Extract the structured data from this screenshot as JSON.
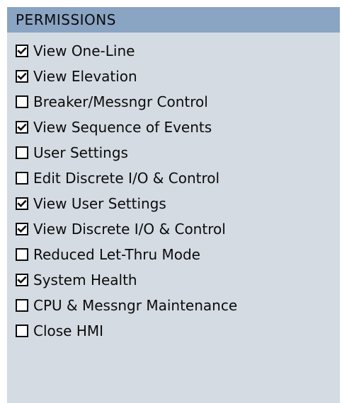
{
  "panel": {
    "title": "PERMISSIONS",
    "items": [
      {
        "label": "View One-Line",
        "checked": true
      },
      {
        "label": "View Elevation",
        "checked": true
      },
      {
        "label": "Breaker/Messngr Control",
        "checked": false
      },
      {
        "label": "View Sequence of Events",
        "checked": true
      },
      {
        "label": "User Settings",
        "checked": false
      },
      {
        "label": "Edit Discrete I/O & Control",
        "checked": false
      },
      {
        "label": "View User Settings",
        "checked": true
      },
      {
        "label": "View Discrete I/O & Control",
        "checked": true
      },
      {
        "label": "Reduced Let-Thru Mode",
        "checked": false
      },
      {
        "label": "System Health",
        "checked": true
      },
      {
        "label": "CPU & Messngr Maintenance",
        "checked": false
      },
      {
        "label": "Close HMI",
        "checked": false
      }
    ]
  },
  "colors": {
    "header_bg": "#8aa4c3",
    "panel_bg": "#d4dbe3",
    "checkbox_border": "#0a0a0a",
    "checkmark": "#111111"
  },
  "icons": {
    "checkmark": "checkmark-icon"
  }
}
